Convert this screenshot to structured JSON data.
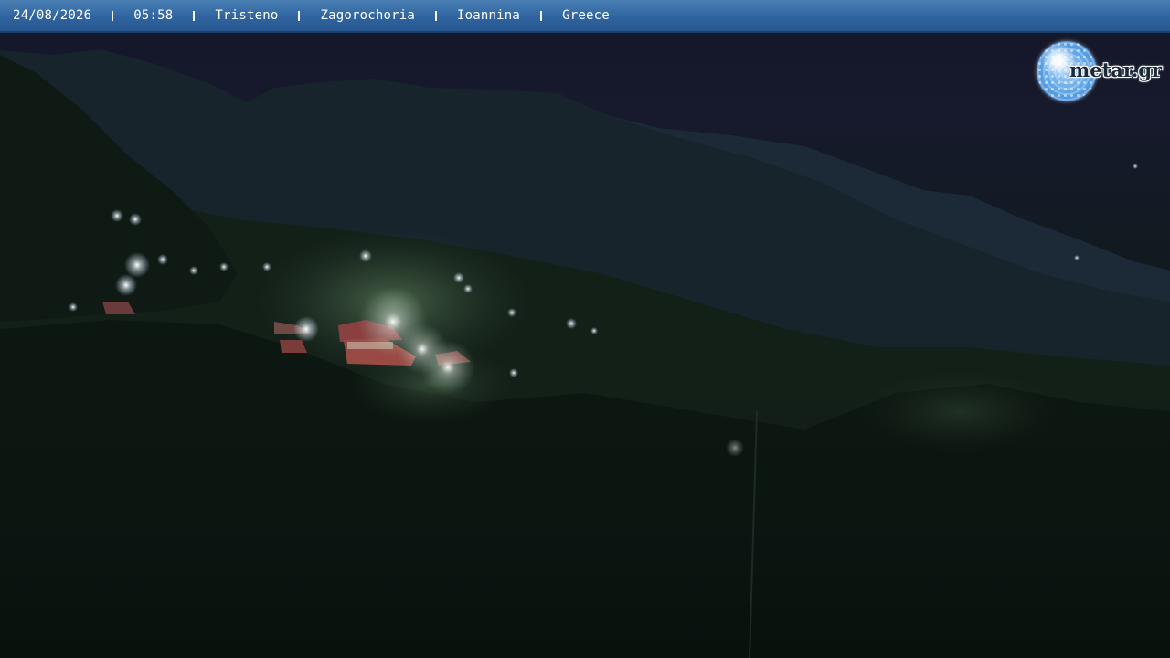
{
  "banner": {
    "date": "24/08/2026",
    "time": "05:58",
    "village": "Tristeno",
    "region": "Zagorochoria",
    "prefecture": "Ioannina",
    "country": "Greece"
  },
  "logo": {
    "text": "metar.gr",
    "icon": "globe-icon"
  },
  "colors": {
    "banner_blue": "#2f64a0",
    "sky": "#161a2c",
    "mountain": "#1a2a34",
    "foliage": "#0e1814",
    "lamp": "#fffbe6"
  }
}
